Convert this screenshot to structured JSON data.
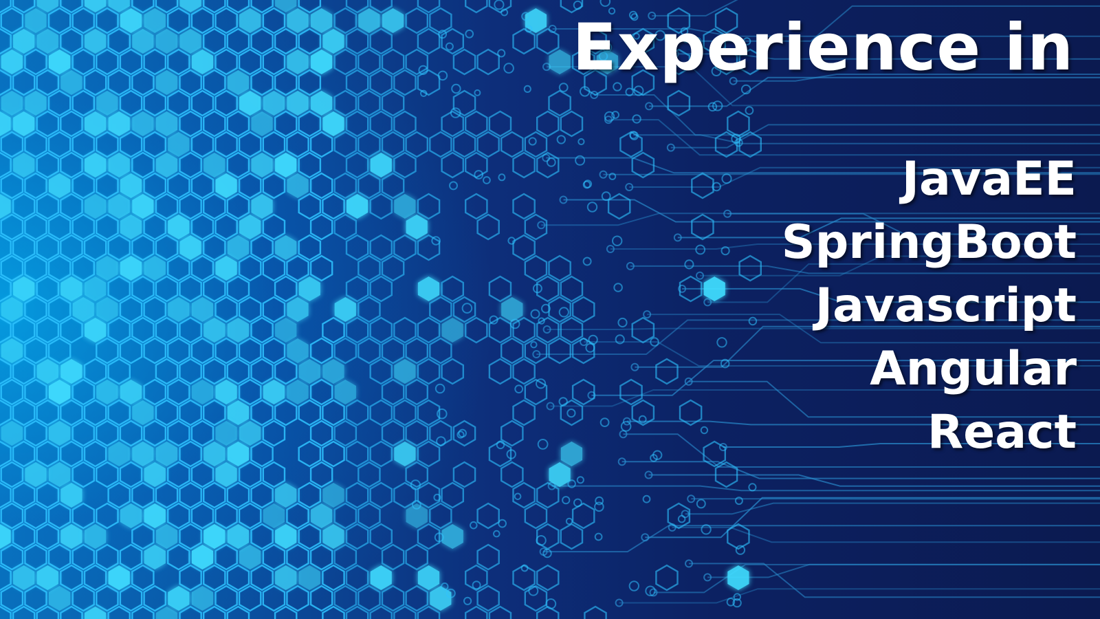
{
  "banner": {
    "headline": "Experience in",
    "technologies": [
      "JavaEE",
      "SpringBoot",
      "Javascript",
      "Angular",
      "React"
    ]
  },
  "colors": {
    "background_dark": "#0b1a50",
    "background_bright": "#0a6fb8",
    "hex_outline": "#2fc3ff",
    "hex_glow": "#3fdcff",
    "circuit_trace": "#2a8fd0",
    "text": "#ffffff"
  },
  "decorations": {
    "pattern_left": "hexagon-mesh",
    "pattern_right": "circuit-traces"
  }
}
